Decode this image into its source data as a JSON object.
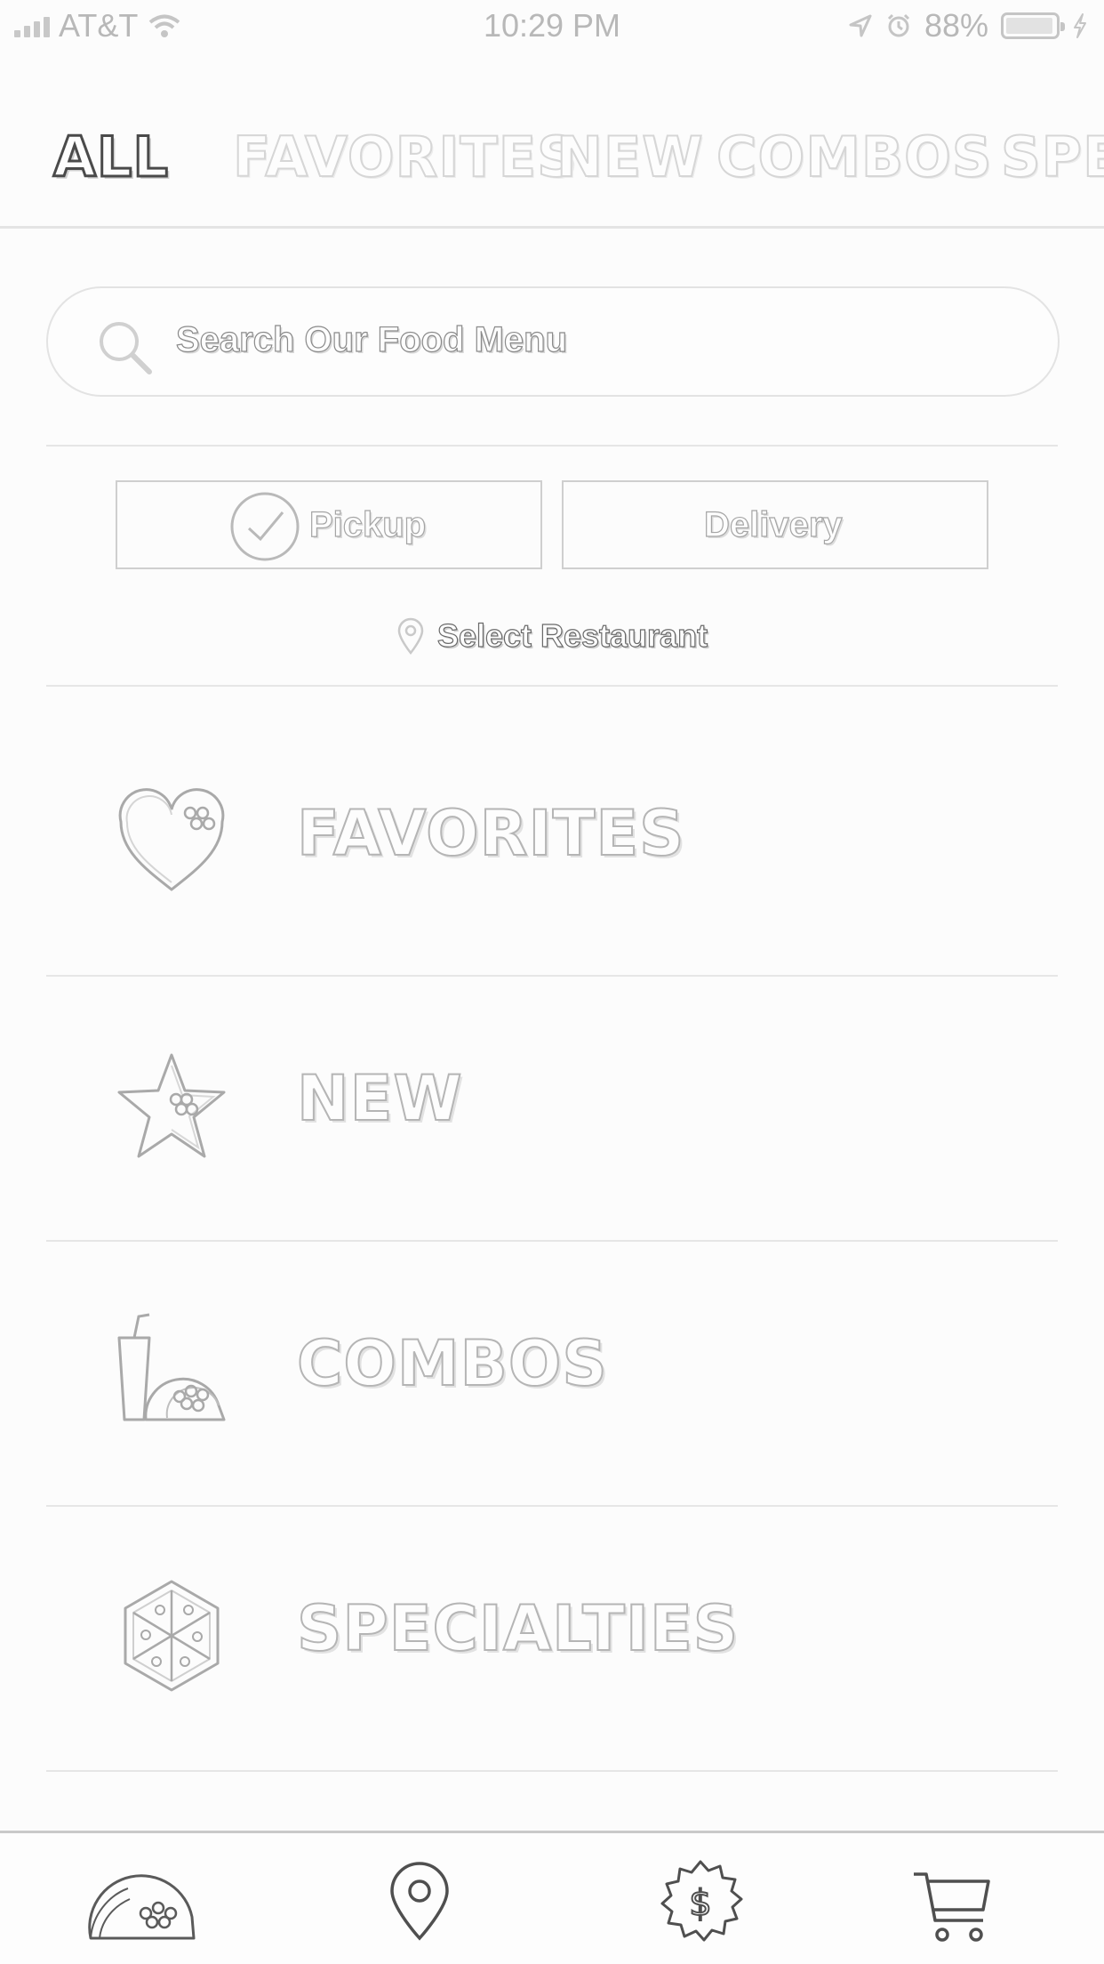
{
  "status_bar": {
    "carrier": "AT&T",
    "time": "10:29 PM",
    "battery": "88%",
    "battery_level": 0.88,
    "icons": [
      "signal-icon",
      "wifi-icon",
      "location-arrow-icon",
      "alarm-icon",
      "battery-icon",
      "charging-icon"
    ]
  },
  "tabs": [
    {
      "label": "ALL",
      "active": true
    },
    {
      "label": "FAVORITES",
      "active": false
    },
    {
      "label": "NEW",
      "active": false
    },
    {
      "label": "COMBOS",
      "active": false
    },
    {
      "label": "SPEC",
      "active": false
    }
  ],
  "search": {
    "placeholder": "Search Our Food Menu",
    "icon": "search-icon"
  },
  "order_type": {
    "pickup_label": "Pickup",
    "delivery_label": "Delivery",
    "selected": "Pickup"
  },
  "restaurant": {
    "label": "Select Restaurant",
    "icon": "map-pin-icon"
  },
  "categories": [
    {
      "label": "FAVORITES",
      "icon": "heart-icon"
    },
    {
      "label": "NEW",
      "icon": "star-icon"
    },
    {
      "label": "COMBOS",
      "icon": "drink-taco-icon"
    },
    {
      "label": "SPECIALTIES",
      "icon": "crunchwrap-icon"
    }
  ],
  "bottom_nav": [
    {
      "name": "menu",
      "icon": "taco-icon"
    },
    {
      "name": "locations",
      "icon": "location-pin-icon"
    },
    {
      "name": "rewards",
      "icon": "dollar-badge-icon"
    },
    {
      "name": "cart",
      "icon": "cart-icon"
    }
  ],
  "colors": {
    "background": "#fcfcfc",
    "active_tab_outline": "#4a4a4a",
    "inactive_outline": "#d6d6d6",
    "divider": "#e4e4e4"
  }
}
